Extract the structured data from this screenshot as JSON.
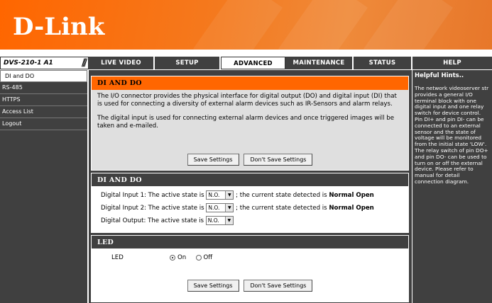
{
  "header": {
    "logo_text": "D-Link"
  },
  "model": {
    "label": "DVS-210-1 A1",
    "divider": "///"
  },
  "nav": {
    "tabs": [
      {
        "label": "LIVE VIDEO"
      },
      {
        "label": "SETUP"
      },
      {
        "label": "ADVANCED"
      },
      {
        "label": "MAINTENANCE"
      },
      {
        "label": "STATUS"
      },
      {
        "label": "HELP"
      }
    ],
    "active_tab": "ADVANCED"
  },
  "sidebar": {
    "items": [
      {
        "label": "DI and DO"
      },
      {
        "label": "RS-485"
      },
      {
        "label": "HTTPS"
      },
      {
        "label": "Access List"
      },
      {
        "label": "Logout"
      }
    ],
    "active_item": "DI and DO"
  },
  "intro": {
    "title": "DI AND DO",
    "para1": "The I/O connector provides the physical interface for digital output (DO) and digital input (DI) that is used for connecting a diversity of external alarm devices such as IR-Sensors and alarm relays.",
    "para2": "The digital input is used for connecting external alarm devices and once triggered images will be taken and e-mailed.",
    "save_label": "Save Settings",
    "dont_save_label": "Don't Save Settings"
  },
  "dido": {
    "title": "DI AND DO",
    "input1_label": "Digital Input 1: The active state is",
    "input1_value": "N.O.",
    "input1_mid": "; the current state detected is",
    "input1_state": "Normal Open",
    "input2_label": "Digital Input 2: The active state is",
    "input2_value": "N.O.",
    "input2_mid": "; the current state detected is",
    "input2_state": "Normal Open",
    "output_label": "Digital Output: The active state is",
    "output_value": "N.O."
  },
  "led": {
    "title": "LED",
    "label": "LED",
    "on_label": "On",
    "off_label": "Off",
    "selected": "On",
    "save_label": "Save Settings",
    "dont_save_label": "Don't Save Settings"
  },
  "help": {
    "title": "Helpful Hints..",
    "text": "The network videoserver str provides a general I/O terminal block with one digital input and one relay switch for device control. Pin DI+ and pin DI- can be connected to an external sensor and the state of voltage will be monitored from the initial state 'LOW'. The relay switch of pin DO+ and pin DO- can be used to turn on or off the external device. Please refer to manual for detail connection diagram."
  },
  "colors": {
    "brand_orange": "#ff6600",
    "dark_gray": "#404040",
    "panel_gray": "#dfdfdf"
  }
}
